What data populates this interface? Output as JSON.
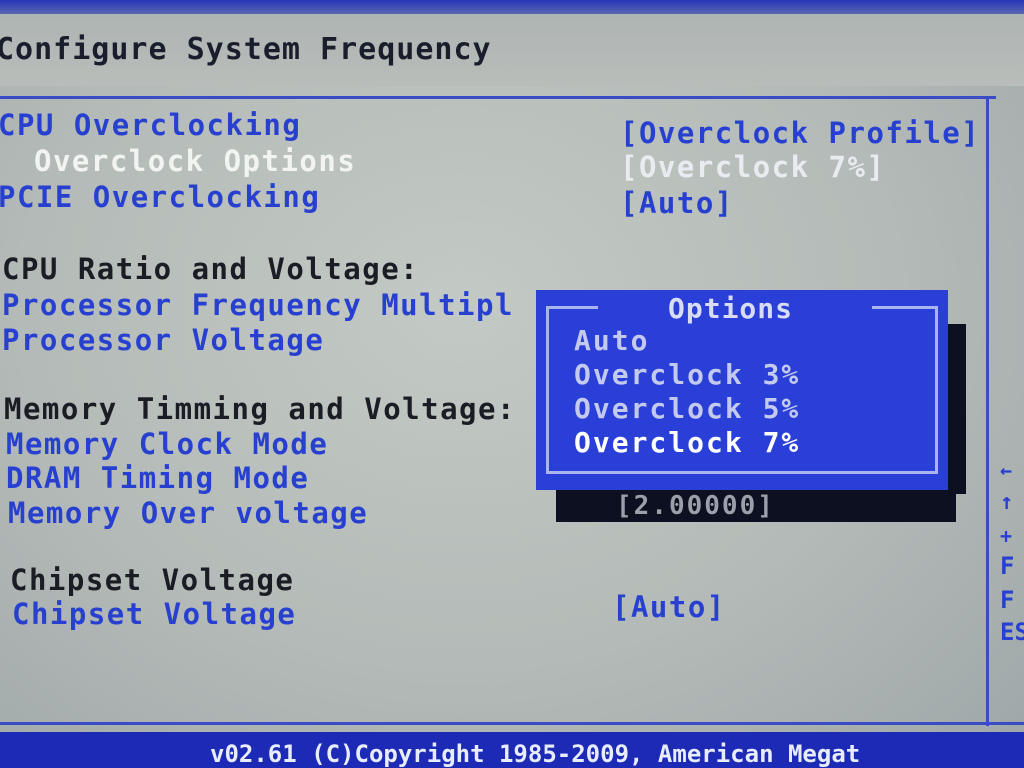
{
  "title": "Configure System Frequency",
  "rows": [
    {
      "label": "CPU Overclocking",
      "value": "[Overclock Profile]"
    },
    {
      "label": "Overclock Options",
      "value": "[Overclock  7%]"
    },
    {
      "label": "PCIE Overclocking",
      "value": "[Auto]"
    }
  ],
  "sections": {
    "cpu": "CPU Ratio and Voltage:",
    "memory": "Memory Timming and Voltage:",
    "chipset": "Chipset Voltage"
  },
  "cpu_items": [
    "Processor Frequency Multipl",
    "Processor Voltage"
  ],
  "memory_items": [
    "Memory Clock Mode",
    "DRAM Timing Mode",
    "Memory Over voltage"
  ],
  "memory_over_voltage_value": "[2.00000]",
  "chipset_item": {
    "label": "Chipset Voltage",
    "value": "[Auto]"
  },
  "popup": {
    "title": "Options",
    "options": [
      "Auto",
      "Overclock  3%",
      "Overclock  5%",
      "Overclock  7%"
    ],
    "selected_index": 3
  },
  "help_glyphs": [
    "←",
    "↑",
    "+",
    "F",
    "F",
    "ES"
  ],
  "footer": "v02.61 (C)Copyright 1985-2009, American Megat",
  "colors": {
    "background": "#b8bdba",
    "item_text": "#2840d0",
    "popup_bg": "#2a3fd8",
    "selected_item": "#f2f4f2"
  }
}
